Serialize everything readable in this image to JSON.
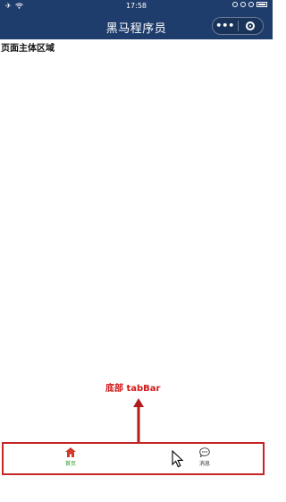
{
  "status_bar": {
    "time": "17:58"
  },
  "nav": {
    "title": "黑马程序员",
    "more_label": "•••"
  },
  "page": {
    "body_text": "页面主体区域"
  },
  "annotation": {
    "label": "底部 tabBar",
    "color": "#d01818"
  },
  "tabbar": {
    "items": [
      {
        "label": "首页",
        "icon": "home-icon",
        "active": true,
        "color": "#2a9a2a"
      },
      {
        "label": "消息",
        "icon": "message-icon",
        "active": false,
        "color": "#333333"
      }
    ]
  },
  "colors": {
    "nav_bg": "#1f3d6c",
    "frame": "#c62525"
  }
}
